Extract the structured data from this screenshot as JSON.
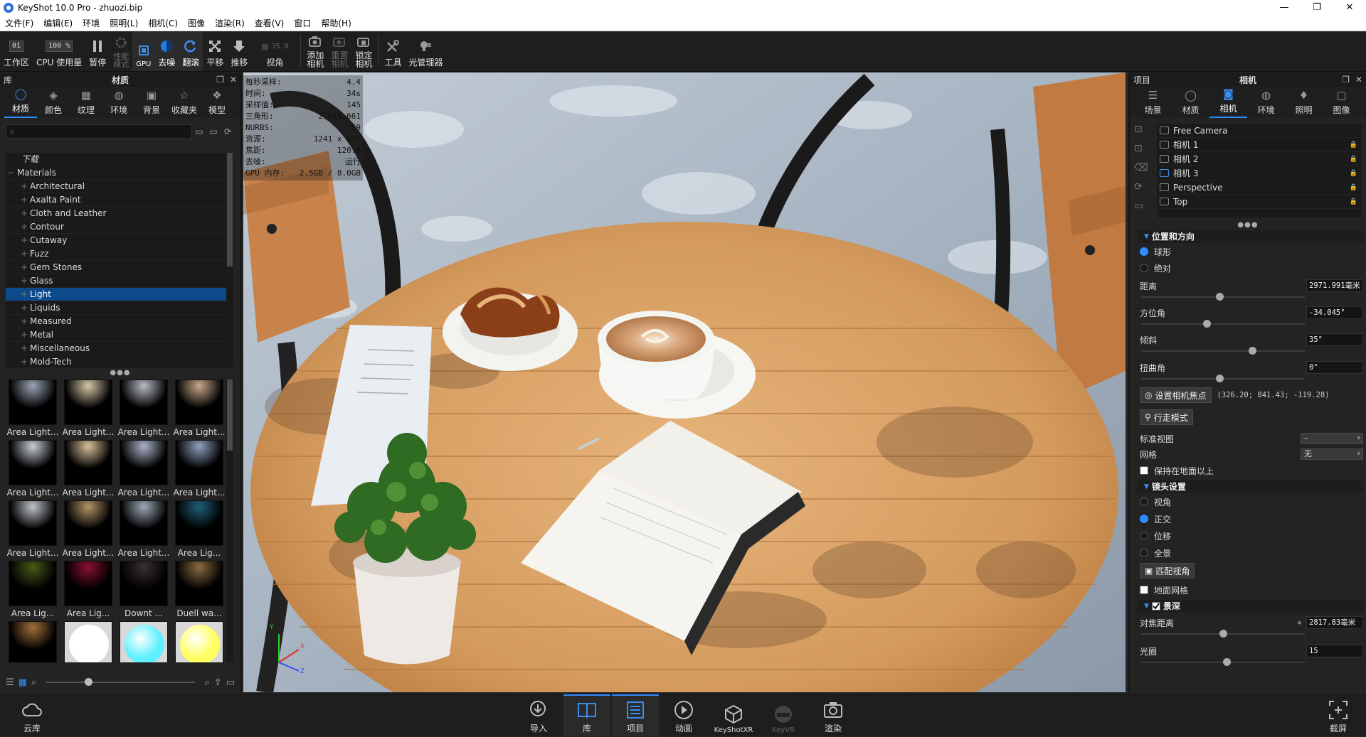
{
  "title_bar": {
    "app_title": "KeyShot 10.0 Pro  - zhuozi.bip",
    "minimize": "—",
    "maximize": "❐",
    "close": "✕"
  },
  "menu": [
    "文件(F)",
    "编辑(E)",
    "环境",
    "照明(L)",
    "相机(C)",
    "图像",
    "渲染(R)",
    "查看(V)",
    "窗口",
    "帮助(H)"
  ],
  "toolbar": {
    "workspace": {
      "value": "01",
      "label": "工作区"
    },
    "cpu_usage": {
      "value": "100 %",
      "label": "CPU 使用量"
    },
    "pause": "暂停",
    "perf_mode": "性能\n模式",
    "gpu": "GPU",
    "denoise": "去噪",
    "tumble": "翻滚",
    "pan": "平移",
    "dolly": "推移",
    "fov": {
      "value": "35.0",
      "label": "视角"
    },
    "add_camera": "添加\n相机",
    "reset_camera": "重置\n相机",
    "lock_camera": "锁定\n相机",
    "tools": "工具",
    "light_manager": "光管理器"
  },
  "library": {
    "title": "库",
    "panel_title": "材质",
    "tabs": [
      "材质",
      "颜色",
      "纹理",
      "环境",
      "背景",
      "收藏夹",
      "模型"
    ],
    "active_tab": "材质",
    "search_placeholder": "",
    "tree_downloads": "下载",
    "tree_root": "Materials",
    "tree_items": [
      "Architectural",
      "Axalta Paint",
      "Cloth and Leather",
      "Contour",
      "Cutaway",
      "Fuzz",
      "Gem Stones",
      "Glass",
      "Light",
      "Liquids",
      "Measured",
      "Metal",
      "Miscellaneous",
      "Mold-Tech"
    ],
    "selected_item": "Light",
    "thumbnails": [
      {
        "label": "Area Light...",
        "color": "#9aa4b4"
      },
      {
        "label": "Area Light...",
        "color": "#d6c8a8"
      },
      {
        "label": "Area Light...",
        "color": "#b8bcc6"
      },
      {
        "label": "Area Light...",
        "color": "#c9a98a"
      },
      {
        "label": "Area Light...",
        "color": "#c8ccd6"
      },
      {
        "label": "Area Light...",
        "color": "#d9c09a"
      },
      {
        "label": "Area Light...",
        "color": "#aab4c8"
      },
      {
        "label": "Area Light...",
        "color": "#8fa0c0"
      },
      {
        "label": "Area Light...",
        "color": "#c0c4cc"
      },
      {
        "label": "Area Light...",
        "color": "#b59468"
      },
      {
        "label": "Area Light...",
        "color": "#9ea8b8"
      },
      {
        "label": "Area Lig...",
        "color": "#1f5f78"
      },
      {
        "label": "Area Lig...",
        "color": "#4a5a18"
      },
      {
        "label": "Area Lig...",
        "color": "#8a1030"
      },
      {
        "label": "Downt ...",
        "color": "#3a3030"
      },
      {
        "label": "Duell wa...",
        "color": "#8a6a40"
      },
      {
        "label": "",
        "color": "#a0703a"
      },
      {
        "label": "",
        "color": "#ffffff",
        "sphere": true
      },
      {
        "label": "",
        "color": "#5ff0ff",
        "sphere": true
      },
      {
        "label": "",
        "color": "#ffff60",
        "sphere": true
      }
    ]
  },
  "viewport": {
    "stats": [
      {
        "k": "每秒采样:",
        "v": "4.4"
      },
      {
        "k": "时间:",
        "v": "34s"
      },
      {
        "k": "采样值:",
        "v": "145"
      },
      {
        "k": "三角形:",
        "v": "2,015,661"
      },
      {
        "k": "NURBS:",
        "v": "59"
      },
      {
        "k": "资源:",
        "v": "1241 x 871"
      },
      {
        "k": "焦距:",
        "v": "120.0"
      },
      {
        "k": "去噪:",
        "v": "运行"
      },
      {
        "k": "GPU 内存:",
        "v": "2.5GB / 8.0GB"
      }
    ],
    "axis_labels": {
      "x": "X",
      "y": "Y",
      "z": "Z"
    }
  },
  "project": {
    "title": "项目",
    "panel_title": "相机",
    "tabs": [
      "场景",
      "材质",
      "相机",
      "环境",
      "照明",
      "图像"
    ],
    "active_tab": "相机",
    "cameras": [
      {
        "name": "Free Camera",
        "locked": false,
        "active": false
      },
      {
        "name": "相机 1",
        "locked": true,
        "active": false
      },
      {
        "name": "相机 2",
        "locked": true,
        "active": false
      },
      {
        "name": "相机 3",
        "locked": true,
        "active": true
      },
      {
        "name": "Perspective",
        "locked": true,
        "active": false
      },
      {
        "name": "Top",
        "locked": true,
        "active": false
      }
    ],
    "position_section": "位置和方向",
    "mode_spherical": "球形",
    "mode_absolute": "绝对",
    "distance": {
      "label": "距离",
      "value": "2971.991毫米",
      "level": 0.48
    },
    "azimuth": {
      "label": "方位角",
      "value": "-34.045°",
      "level": 0.4
    },
    "inclination": {
      "label": "倾斜",
      "value": "35°",
      "level": 0.68
    },
    "twist": {
      "label": "扭曲角",
      "value": "0°",
      "level": 0.48
    },
    "set_focus_button": "设置相机焦点",
    "focus_coords": "(326.20; 841.43; -119.28)",
    "walk_mode_button": "行走模式",
    "standard_view_label": "标准视图",
    "standard_view_value": "–",
    "grid_label": "网格",
    "grid_value": "无",
    "stay_above_ground": "保持在地面以上",
    "lens_section": "镜头设置",
    "lens_options": [
      "视角",
      "正交",
      "位移",
      "全景"
    ],
    "lens_selected": "正交",
    "match_perspective_button": "匹配视角",
    "ground_grid": "地面网格",
    "dof_section": "景深",
    "focus_distance": {
      "label": "对焦距离",
      "value": "2817.83毫米",
      "level": 0.5
    },
    "aperture": {
      "label": "光圈",
      "value": "15",
      "level": 0.52
    }
  },
  "bottom_bar": {
    "cloud": "云库",
    "import": "导入",
    "library": "库",
    "project": "项目",
    "animation": "动画",
    "keyshotxr": "KeyShotXR",
    "keyvr": "KeyVR",
    "render": "渲染",
    "screenshot": "截屏"
  }
}
